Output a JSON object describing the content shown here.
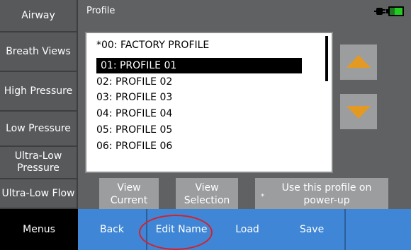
{
  "sidebar": {
    "items": [
      {
        "label": "Airway"
      },
      {
        "label": "Breath Views"
      },
      {
        "label": "High Pressure"
      },
      {
        "label": "Low Pressure"
      },
      {
        "label": "Ultra-Low Pressure"
      },
      {
        "label": "Ultra-Low Flow"
      }
    ]
  },
  "header": {
    "title": "Profile"
  },
  "profiles": [
    "*00: FACTORY PROFILE",
    "01: PROFILE 01",
    "02: PROFILE 02",
    "03: PROFILE 03",
    "04: PROFILE 04",
    "05: PROFILE 05",
    "06: PROFILE 06"
  ],
  "selected_profile": "01: PROFILE 01",
  "buttons": {
    "view_current": "View Current",
    "view_selection": "View Selection",
    "use_on_powerup": "Use this profile on power-up",
    "use_on_powerup_mark": "*"
  },
  "bottombar": {
    "menus": "Menus",
    "back": "Back",
    "edit_name": "Edit Name",
    "load": "Load",
    "save": "Save"
  },
  "colors": {
    "accent_blue": "#3f86d6",
    "arrow_orange": "#e49a22",
    "annotation_red": "#d8202a",
    "battery_green": "#22cc22"
  },
  "icons": {
    "scroll_up": "arrow-up-icon",
    "scroll_down": "arrow-down-icon",
    "power": "ac-plug-icon",
    "battery": "battery-icon"
  },
  "battery_level": 0.6
}
